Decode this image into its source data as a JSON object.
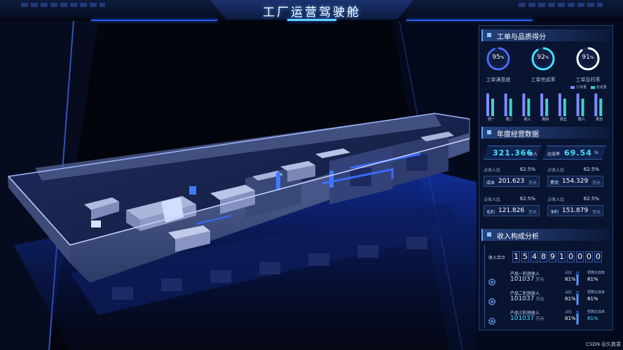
{
  "header": {
    "title": "工厂运营驾驶舱"
  },
  "work_orders": {
    "title": "工单与品质得分",
    "gauges": [
      {
        "value": "95",
        "unit": "%",
        "label": "工单满意度",
        "level": 0.95,
        "color": "#4a6cff"
      },
      {
        "value": "92",
        "unit": "%",
        "label": "工单完成率",
        "level": 0.92,
        "color": "#3fe3ff"
      },
      {
        "value": "91",
        "unit": "%",
        "label": "工单及时率",
        "level": 0.91,
        "color": "#ffffff"
      }
    ],
    "legend": {
      "a": "订单量",
      "b": "完成量",
      "a_color": "#7c8cff",
      "b_color": "#3fd0d0"
    },
    "chart_data": {
      "type": "bar",
      "categories": [
        "周一",
        "周二",
        "周三",
        "周四",
        "周五",
        "周六",
        "周日"
      ],
      "series": [
        {
          "name": "订单量",
          "values": [
            9,
            9,
            9,
            9,
            9,
            9,
            9
          ]
        },
        {
          "name": "完成量",
          "values": [
            7,
            7,
            7,
            7,
            7,
            7,
            7
          ]
        }
      ],
      "ylim": [
        0,
        10
      ]
    }
  },
  "annual": {
    "title": "年度经营数据",
    "income": {
      "value": "321.366",
      "label": "收入"
    },
    "rate": {
      "label": "达成率",
      "value": "69.54",
      "unit": "%"
    },
    "cards": [
      {
        "top_label": "占收入比",
        "top_value": "62.5%",
        "label": "成本",
        "value": "201.623",
        "unit": "万元"
      },
      {
        "top_label": "占收入比",
        "top_value": "62.5%",
        "label": "费用",
        "value": "154.329",
        "unit": "万元"
      },
      {
        "top_label": "占收入比",
        "top_value": "62.5%",
        "label": "毛利",
        "value": "121.826",
        "unit": "万元"
      },
      {
        "top_label": "占收入比",
        "top_value": "62.5%",
        "label": "净利",
        "value": "151.879",
        "unit": "万元"
      }
    ]
  },
  "income": {
    "title": "收入构成分析",
    "total_label": "收入合计",
    "digits": [
      "1",
      "5",
      "4",
      "8",
      "9",
      "1",
      "0",
      "0",
      "0",
      "0"
    ],
    "rows": [
      {
        "name": "产品一利润收入",
        "value": "101037",
        "unit": "万元",
        "ratio_label": "占比",
        "ratio": "81%",
        "target_label": "预算达成率",
        "target": "81%",
        "level": 0.81
      },
      {
        "name": "产品二利润收入",
        "value": "101037",
        "unit": "万元",
        "ratio_label": "占比",
        "ratio": "81%",
        "target_label": "预算达成率",
        "target": "81%",
        "level": 0.81
      },
      {
        "name": "产品三利润收入",
        "value": "101037",
        "unit": "万元",
        "ratio_label": "占比",
        "ratio": "81%",
        "target_label": "预算达成率",
        "target": "81%",
        "level": 0.81
      }
    ]
  },
  "watermark": "CSDN @久数君"
}
